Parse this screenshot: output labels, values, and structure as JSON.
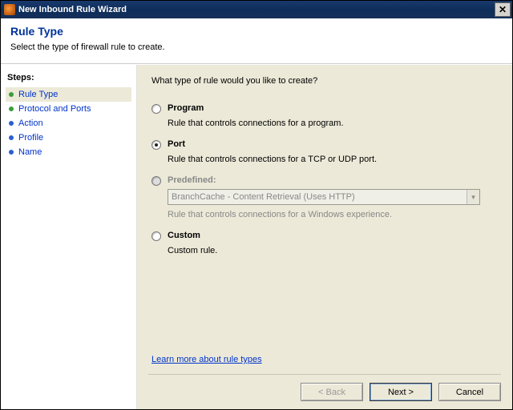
{
  "window": {
    "title": "New Inbound Rule Wizard",
    "close_glyph": "✕"
  },
  "header": {
    "title": "Rule Type",
    "description": "Select the type of firewall rule to create."
  },
  "sidebar": {
    "label": "Steps:",
    "items": [
      {
        "label": "Rule Type",
        "current": true,
        "color": "green"
      },
      {
        "label": "Protocol and Ports",
        "current": false,
        "color": "green"
      },
      {
        "label": "Action",
        "current": false,
        "color": "blue"
      },
      {
        "label": "Profile",
        "current": false,
        "color": "blue"
      },
      {
        "label": "Name",
        "current": false,
        "color": "blue"
      }
    ]
  },
  "main": {
    "prompt": "What type of rule would you like to create?",
    "options": {
      "program": {
        "label": "Program",
        "desc": "Rule that controls connections for a program."
      },
      "port": {
        "label": "Port",
        "desc": "Rule that controls connections for a TCP or UDP port."
      },
      "predefined": {
        "label": "Predefined:",
        "dropdown_value": "BranchCache - Content Retrieval (Uses HTTP)",
        "desc": "Rule that controls connections for a Windows experience."
      },
      "custom": {
        "label": "Custom",
        "desc": "Custom rule."
      }
    },
    "selected": "port",
    "learn_link": "Learn more about rule types"
  },
  "buttons": {
    "back": "< Back",
    "next": "Next >",
    "cancel": "Cancel"
  }
}
